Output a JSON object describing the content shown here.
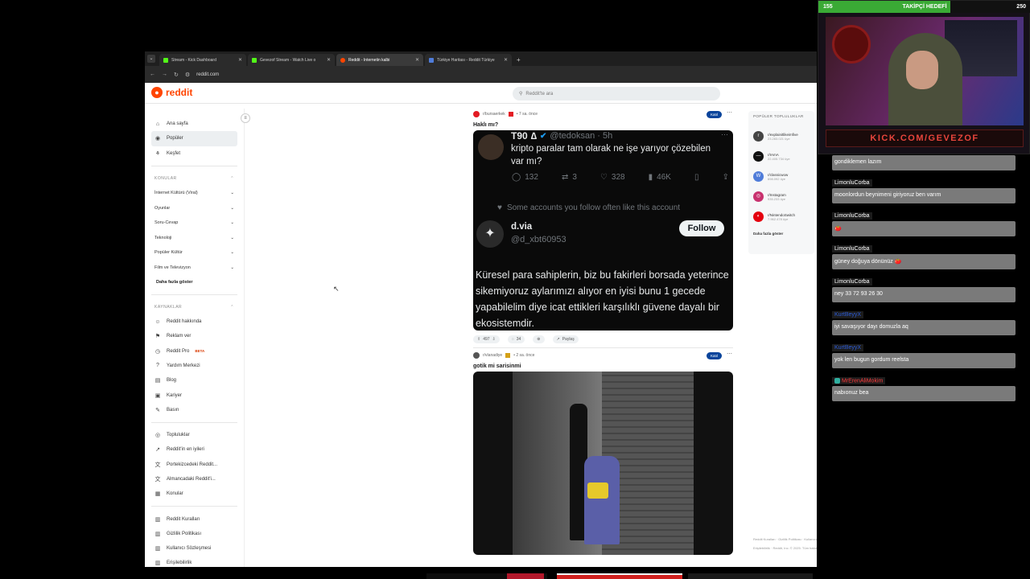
{
  "browser": {
    "tabs": [
      {
        "title": "Stream - Kick Dashboard",
        "color": "#53fc18"
      },
      {
        "title": "Gevezof Stream - Watch Live o",
        "color": "#53fc18"
      },
      {
        "title": "Reddit - İnternetin kalbi",
        "color": "#ff4500"
      },
      {
        "title": "Türkiye Haritası - Reddit Türkiye",
        "color": "#4f7cd9"
      }
    ],
    "new_tab": "+",
    "url": "reddit.com",
    "nav": {
      "back": "←",
      "forward": "→",
      "reload": "↻"
    }
  },
  "reddit": {
    "logo_text": "reddit",
    "search_placeholder": "Reddit'te ara",
    "sidebar": {
      "nav": [
        {
          "label": "Ana sayfa",
          "icon": "⌂"
        },
        {
          "label": "Popüler",
          "icon": "◉"
        },
        {
          "label": "Keşfet",
          "icon": "⚘"
        }
      ],
      "topics_header": "KONULAR",
      "topics": [
        "İnternet Kültürü (Viral)",
        "Oyunlar",
        "Soru-Cevap",
        "Teknoloji",
        "Popüler Kültür",
        "Film ve Televizyon"
      ],
      "more": "Daha fazla göster",
      "resources_header": "KAYNAKLAR",
      "resources": [
        {
          "label": "Reddit hakkında",
          "icon": "☺"
        },
        {
          "label": "Reklam ver",
          "icon": "⚑"
        },
        {
          "label": "Reddit Pro",
          "icon": "◷",
          "badge": "BETA"
        },
        {
          "label": "Yardım Merkezi",
          "icon": "?"
        },
        {
          "label": "Blog",
          "icon": "▤"
        },
        {
          "label": "Kariyer",
          "icon": "▣"
        },
        {
          "label": "Basın",
          "icon": "✎"
        }
      ],
      "resources2": [
        {
          "label": "Topluluklar",
          "icon": "◎"
        },
        {
          "label": "Reddit'in en iyileri",
          "icon": "↗"
        },
        {
          "label": "Portekizcedeki Reddit...",
          "icon": "文"
        },
        {
          "label": "Almancadaki Reddit'i...",
          "icon": "文"
        },
        {
          "label": "Konular",
          "icon": "▦"
        }
      ],
      "legal": [
        {
          "label": "Reddit Kuralları",
          "icon": "▥"
        },
        {
          "label": "Gizlilik Politikası",
          "icon": "▥"
        },
        {
          "label": "Kullanıcı Sözleşmesi",
          "icon": "▥"
        },
        {
          "label": "Erişilebilirlik",
          "icon": "▥"
        }
      ]
    },
    "post1": {
      "subreddit": "r/bursaerkek",
      "age": "• 7 sa. önce",
      "join": "Katıl",
      "title": "Haklı mı?",
      "votes": "497",
      "comments": "34",
      "share": "Paylaş",
      "tweet": {
        "name": "T90",
        "symbol": "∆",
        "handle": "@tedoksan · 5h",
        "text": "kripto paralar tam olarak ne işe yarıyor çözebilen var mı?",
        "replies": "132",
        "retweets": "3",
        "likes": "328",
        "views": "46K",
        "follow_note": "Some accounts you follow often like this account",
        "account_name": "d.via",
        "account_handle": "@d_xbt60953",
        "follow_button": "Follow",
        "body": "Küresel para sahiplerin, biz bu fakirleri borsada yeterince sikemiyoruz aylarımızı alıyor en iyisi bunu 1 gecede yapabilelim diye icat ettikleri karşılıklı güvene dayalı bir ekosistemdir."
      }
    },
    "post2": {
      "subreddit": "r/vlanadiye",
      "age": "• 2 sa. önce",
      "join": "Katıl",
      "title": "gotik mi sarisinmi"
    },
    "popular": {
      "header": "POPÜLER TOPLULUKLAR",
      "items": [
        {
          "name": "r/explainitlikeimfive",
          "members": "23.283.021 üye",
          "color": "#444"
        },
        {
          "name": "r/IAmA",
          "members": "22.405.734 üye",
          "color": "#111"
        },
        {
          "name": "r/classicwow",
          "members": "698.092 üye",
          "color": "#4f7cd9"
        },
        {
          "name": "r/Instagram",
          "members": "935.233 üye",
          "color": "#c8326e"
        },
        {
          "name": "r/NintendoSwitch",
          "members": "7.962.478 üye",
          "color": "#e4000f"
        }
      ],
      "more": "Daha fazla göster"
    },
    "footer": "Reddit Kuralları · Gizlilik Politikası · Kullanıcı Sözleşmesi · Erişilebilirlik · Reddit, Inc. © 2025. Tüm hakları saklıdır."
  },
  "stream": {
    "goal_left": "155",
    "goal_label": "TAKİPÇİ HEDEFİ",
    "goal_right": "250",
    "goal_fraction": 0.62,
    "kick_text": "KICK.COM/GEVEZOF",
    "chat": [
      {
        "user": "",
        "text": "gondiklemen lazım"
      },
      {
        "user": "LimonluCorba",
        "text": "moonlordun beynimeni giriyoruz ben varım",
        "style": ""
      },
      {
        "user": "LimonluCorba",
        "text": "🍅",
        "style": ""
      },
      {
        "user": "LimonluCorba",
        "text": "güney doğuya dönünüz 🍅",
        "style": ""
      },
      {
        "user": "LimonluCorba",
        "text": "ney 33 72 93 26 30",
        "style": ""
      },
      {
        "user": "KurtBeyyX",
        "text": "iyi savaşıyor dayı domuzla aq",
        "style": "blue"
      },
      {
        "user": "KurtBeyyX",
        "text": "yok len bugun gordum reelsta",
        "style": "blue"
      },
      {
        "user": "MrErenAliMokim",
        "text": "nabıonuz bea",
        "style": "red"
      }
    ]
  }
}
